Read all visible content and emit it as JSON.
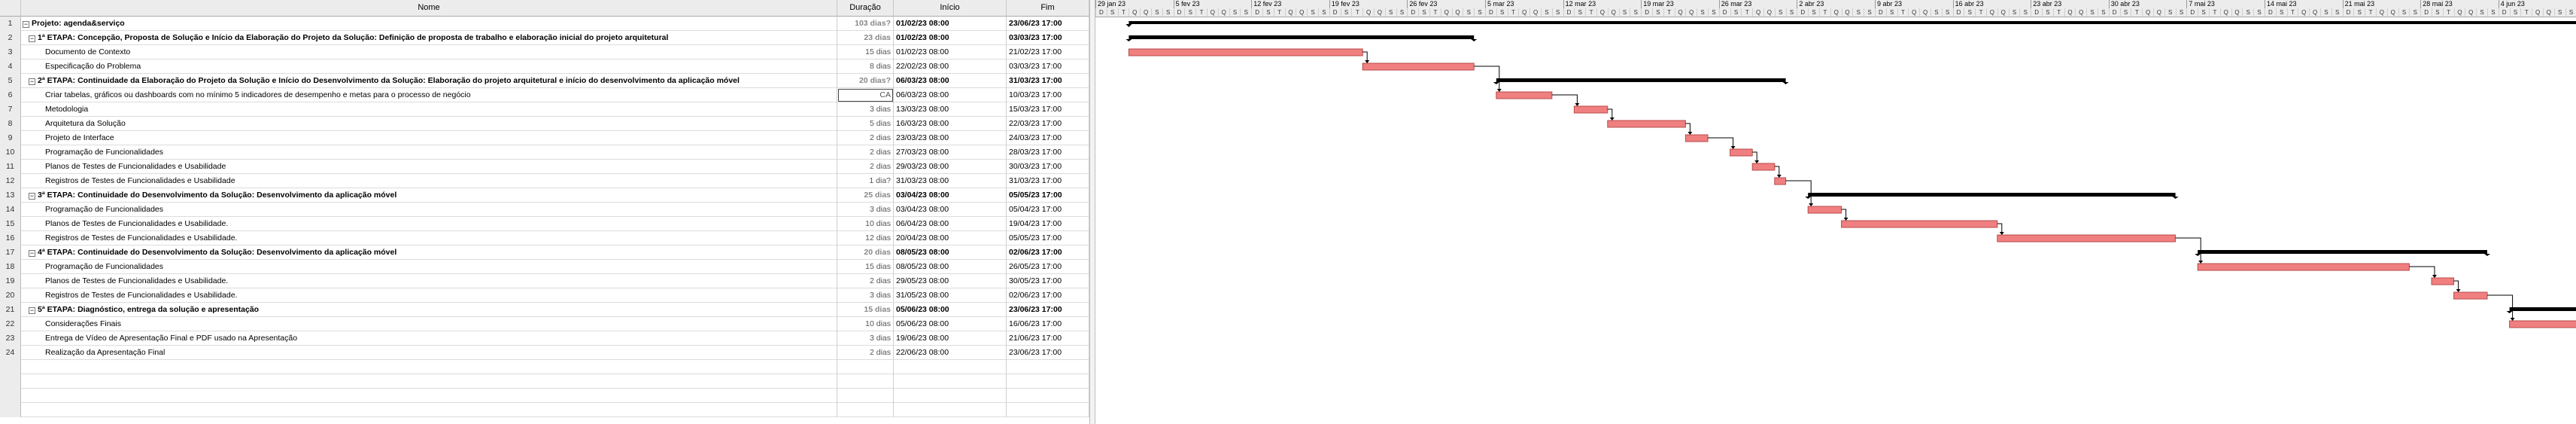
{
  "columns": {
    "name": "Nome",
    "duration": "Duração",
    "start": "Início",
    "finish": "Fim"
  },
  "timescale": {
    "weeks": [
      "29 jan 23",
      "5 fev 23",
      "12 fev 23",
      "19 fev 23",
      "26 fev 23",
      "5 mar 23",
      "12 mar 23",
      "19 mar 23",
      "26 mar 23",
      "2 abr 23",
      "9 abr 23",
      "16 abr 23",
      "23 abr 23",
      "30 abr 23",
      "7 mai 23",
      "14 mai 23",
      "21 mai 23",
      "28 mai 23",
      "4 jun 23"
    ],
    "day_letters": [
      "D",
      "S",
      "T",
      "Q",
      "Q",
      "S",
      "S"
    ]
  },
  "colors": {
    "task_bar": "#f08080",
    "task_border": "#b84a4a",
    "summary_bar": "#000000"
  },
  "rows": [
    {
      "n": "1",
      "name": "Projeto: agenda&serviço",
      "dur": "103 dias?",
      "start": "01/02/23 08:00",
      "finish": "23/06/23 17:00",
      "summary": true,
      "level": 0
    },
    {
      "n": "2",
      "name": "1ª ETAPA: Concepção, Proposta de Solução e Início da Elaboração do Projeto da Solução: Definição de proposta de trabalho e elaboração inicial do projeto arquitetural",
      "dur": "23 dias",
      "start": "01/02/23 08:00",
      "finish": "03/03/23 17:00",
      "summary": true,
      "level": 1
    },
    {
      "n": "3",
      "name": "Documento de Contexto",
      "dur": "15 dias",
      "start": "01/02/23 08:00",
      "finish": "21/02/23 17:00",
      "summary": false,
      "level": 2
    },
    {
      "n": "4",
      "name": "Especificação do Problema",
      "dur": "8 dias",
      "start": "22/02/23 08:00",
      "finish": "03/03/23 17:00",
      "summary": false,
      "level": 2
    },
    {
      "n": "5",
      "name": "2ª ETAPA: Continuidade da Elaboração do Projeto da Solução e Início do Desenvolvimento da Solução: Elaboração do projeto arquitetural e início do  desenvolvimento da aplicação móvel",
      "dur": "20 dias?",
      "start": "06/03/23 08:00",
      "finish": "31/03/23 17:00",
      "summary": true,
      "level": 1
    },
    {
      "n": "6",
      "name": "Criar tabelas, gráficos ou dashboards com no mínimo 5 indicadores de desempenho e metas para o processo de negócio",
      "dur": "CA",
      "start": "06/03/23 08:00",
      "finish": "10/03/23 17:00",
      "summary": false,
      "level": 2,
      "selected": true
    },
    {
      "n": "7",
      "name": "Metodologia",
      "dur": "3 dias",
      "start": "13/03/23 08:00",
      "finish": "15/03/23 17:00",
      "summary": false,
      "level": 2
    },
    {
      "n": "8",
      "name": "Arquitetura da Solução",
      "dur": "5 dias",
      "start": "16/03/23 08:00",
      "finish": "22/03/23 17:00",
      "summary": false,
      "level": 2
    },
    {
      "n": "9",
      "name": "Projeto de Interface",
      "dur": "2 dias",
      "start": "23/03/23 08:00",
      "finish": "24/03/23 17:00",
      "summary": false,
      "level": 2
    },
    {
      "n": "10",
      "name": "Programação de Funcionalidades",
      "dur": "2 dias",
      "start": "27/03/23 08:00",
      "finish": "28/03/23 17:00",
      "summary": false,
      "level": 2
    },
    {
      "n": "11",
      "name": "Planos de Testes de Funcionalidades  e Usabilidade",
      "dur": "2 dias",
      "start": "29/03/23 08:00",
      "finish": "30/03/23 17:00",
      "summary": false,
      "level": 2
    },
    {
      "n": "12",
      "name": "Registros de Testes de Funcionalidades  e Usabilidade",
      "dur": "1 dia?",
      "start": "31/03/23 08:00",
      "finish": "31/03/23 17:00",
      "summary": false,
      "level": 2
    },
    {
      "n": "13",
      "name": "3ª ETAPA: Continuidade do Desenvolvimento da Solução: Desenvolvimento da aplicação móvel",
      "dur": "25 dias",
      "start": "03/04/23 08:00",
      "finish": "05/05/23 17:00",
      "summary": true,
      "level": 1
    },
    {
      "n": "14",
      "name": "Programação de Funcionalidades",
      "dur": "3 dias",
      "start": "03/04/23 08:00",
      "finish": "05/04/23 17:00",
      "summary": false,
      "level": 2
    },
    {
      "n": "15",
      "name": "Planos de Testes de Funcionalidades  e Usabilidade.",
      "dur": "10 dias",
      "start": "06/04/23 08:00",
      "finish": "19/04/23 17:00",
      "summary": false,
      "level": 2
    },
    {
      "n": "16",
      "name": "Registros de Testes de Funcionalidades  e Usabilidade.",
      "dur": "12 dias",
      "start": "20/04/23 08:00",
      "finish": "05/05/23 17:00",
      "summary": false,
      "level": 2
    },
    {
      "n": "17",
      "name": "4ª ETAPA: Continuidade do Desenvolvimento da Solução: Desenvolvimento da aplicação móvel",
      "dur": "20 dias",
      "start": "08/05/23 08:00",
      "finish": "02/06/23 17:00",
      "summary": true,
      "level": 1
    },
    {
      "n": "18",
      "name": "Programação de Funcionalidades",
      "dur": "15 dias",
      "start": "08/05/23 08:00",
      "finish": "26/05/23 17:00",
      "summary": false,
      "level": 2
    },
    {
      "n": "19",
      "name": "Planos de Testes de Funcionalidades  e Usabilidade.",
      "dur": "2 dias",
      "start": "29/05/23 08:00",
      "finish": "30/05/23 17:00",
      "summary": false,
      "level": 2
    },
    {
      "n": "20",
      "name": "Registros de Testes de Funcionalidades  e Usabilidade.",
      "dur": "3 dias",
      "start": "31/05/23 08:00",
      "finish": "02/06/23 17:00",
      "summary": false,
      "level": 2
    },
    {
      "n": "21",
      "name": "5ª ETAPA: Diagnóstico, entrega da solução e apresentação",
      "dur": "15 dias",
      "start": "05/06/23 08:00",
      "finish": "23/06/23 17:00",
      "summary": true,
      "level": 1
    },
    {
      "n": "22",
      "name": "Considerações Finais",
      "dur": "10 dias",
      "start": "05/06/23 08:00",
      "finish": "16/06/23 17:00",
      "summary": false,
      "level": 2
    },
    {
      "n": "23",
      "name": "Entrega de Vídeo de Apresentação Final e PDF usado na Apresentação",
      "dur": "3 dias",
      "start": "19/06/23 08:00",
      "finish": "21/06/23 17:00",
      "summary": false,
      "level": 2
    },
    {
      "n": "24",
      "name": "Realização da Apresentação Final",
      "dur": "2 dias",
      "start": "22/06/23 08:00",
      "finish": "23/06/23 17:00",
      "summary": false,
      "level": 2
    }
  ]
}
